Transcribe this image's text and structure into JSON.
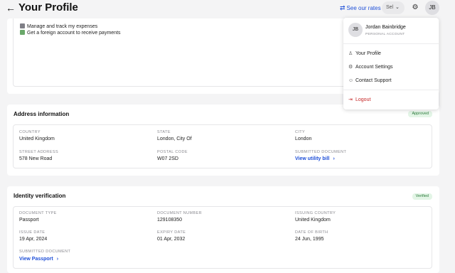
{
  "header": {
    "title": "Your Profile",
    "see_rates": "See our rates",
    "language": "Sel",
    "avatar_initials": "JB"
  },
  "features": [
    "Manage and track my expenses",
    "Get a foreign account to receive payments"
  ],
  "address": {
    "title": "Address information",
    "status": "Approved",
    "fields": {
      "country_label": "COUNTRY",
      "country": "United Kingdom",
      "state_label": "STATE",
      "state": "London, City Of",
      "city_label": "CITY",
      "city": "London",
      "street_label": "STREET ADDRESS",
      "street": "578 New Road",
      "postal_label": "POSTAL CODE",
      "postal": "W07 2SD",
      "doc_label": "SUBMITTED DOCUMENT",
      "doc_link": "View utility bill"
    }
  },
  "identity": {
    "title": "Identity verification",
    "status": "Verified",
    "fields": {
      "doctype_label": "DOCUMENT TYPE",
      "doctype": "Passport",
      "docnum_label": "DOCUMENT NUMBER",
      "docnum": "129108350",
      "issuing_label": "ISSUING COUNTRY",
      "issuing": "United Kingdom",
      "issue_label": "ISSUE DATE",
      "issue": "19 Apr, 2024",
      "expiry_label": "EXPIRY DATE",
      "expiry": "01 Apr, 2032",
      "dob_label": "DATE OF BIRTH",
      "dob": "24 Jun, 1995",
      "doc_label": "SUBMITTED DOCUMENT",
      "doc_link": "View Passport"
    }
  },
  "menu": {
    "avatar_initials": "JB",
    "name": "Jordan Bainbridge",
    "account_type": "PERSONAL ACCOUNT",
    "items": [
      "Your Profile",
      "Account Settings",
      "Contact Support"
    ],
    "logout": "Logout"
  },
  "colors": {
    "accent": "#1e4fd8",
    "success_bg": "#e3f5e6",
    "success_text": "#2b7a3b",
    "danger": "#c62828"
  }
}
